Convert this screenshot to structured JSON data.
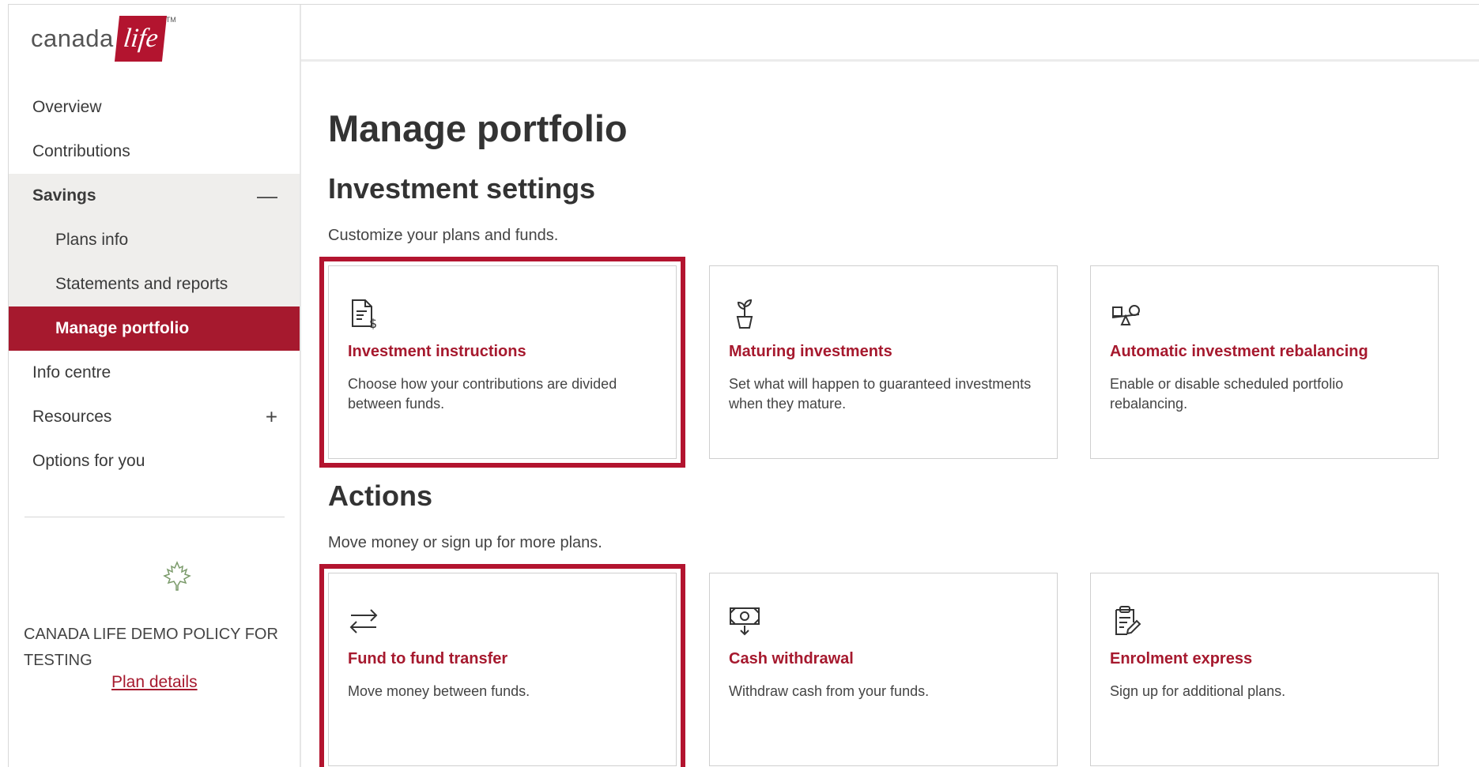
{
  "brand": {
    "word": "canada",
    "box_text": "life",
    "tm": "TM",
    "accent": "#a6192e"
  },
  "sidebar": {
    "items": [
      {
        "label": "Overview"
      },
      {
        "label": "Contributions"
      },
      {
        "label": "Savings",
        "toggle": "—"
      },
      {
        "label": "Plans info"
      },
      {
        "label": "Statements and reports"
      },
      {
        "label": "Manage portfolio"
      },
      {
        "label": "Info centre"
      },
      {
        "label": "Resources",
        "toggle": "+"
      },
      {
        "label": "Options for you"
      }
    ],
    "policy_name": "CANADA LIFE DEMO POLICY FOR TESTING",
    "plan_details": "Plan details",
    "leaf_icon": "maple-leaf-icon"
  },
  "main": {
    "title": "Manage portfolio",
    "settings": {
      "heading": "Investment settings",
      "subtitle": "Customize your plans and funds.",
      "cards": [
        {
          "icon": "document-dollar-icon",
          "title": "Investment instructions",
          "desc": "Choose how your contributions are divided between funds."
        },
        {
          "icon": "plant-pot-icon",
          "title": "Maturing investments",
          "desc": "Set what will happen to guaranteed investments when they mature."
        },
        {
          "icon": "seesaw-shapes-icon",
          "title": "Automatic investment rebalancing",
          "desc": "Enable or disable scheduled portfolio rebalancing."
        }
      ]
    },
    "actions": {
      "heading": "Actions",
      "subtitle": "Move money or sign up for more plans.",
      "cards": [
        {
          "icon": "transfer-arrows-icon",
          "title": "Fund to fund transfer",
          "desc": "Move money between funds."
        },
        {
          "icon": "cash-withdraw-icon",
          "title": "Cash withdrawal",
          "desc": "Withdraw cash from your funds."
        },
        {
          "icon": "clipboard-edit-icon",
          "title": "Enrolment express",
          "desc": "Sign up for additional plans."
        }
      ]
    }
  }
}
